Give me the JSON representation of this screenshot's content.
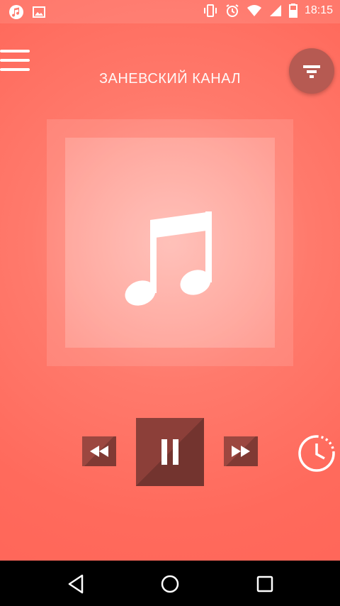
{
  "status_bar": {
    "time": "18:15",
    "left_icons": [
      "music-note-icon",
      "image-icon"
    ],
    "right_icons": [
      "vibrate-icon",
      "alarm-icon",
      "wifi-icon",
      "signal-icon",
      "battery-icon"
    ]
  },
  "header": {
    "station_title": "ЗАНЕВСКИЙ КАНАЛ",
    "menu_icon": "hamburger-menu-icon",
    "filter_icon": "filter-icon"
  },
  "artwork": {
    "icon": "music-note-icon"
  },
  "controls": {
    "rewind_icon": "rewind-icon",
    "pause_icon": "pause-icon",
    "forward_icon": "fast-forward-icon",
    "sleep_timer_icon": "timer-icon"
  },
  "nav_bar": {
    "back_icon": "back-triangle-icon",
    "home_icon": "home-circle-icon",
    "recents_icon": "recents-square-icon"
  },
  "colors": {
    "background": "#ff6a5c",
    "control_fill": "#9c4740",
    "accent_circle": "#b65a52"
  }
}
